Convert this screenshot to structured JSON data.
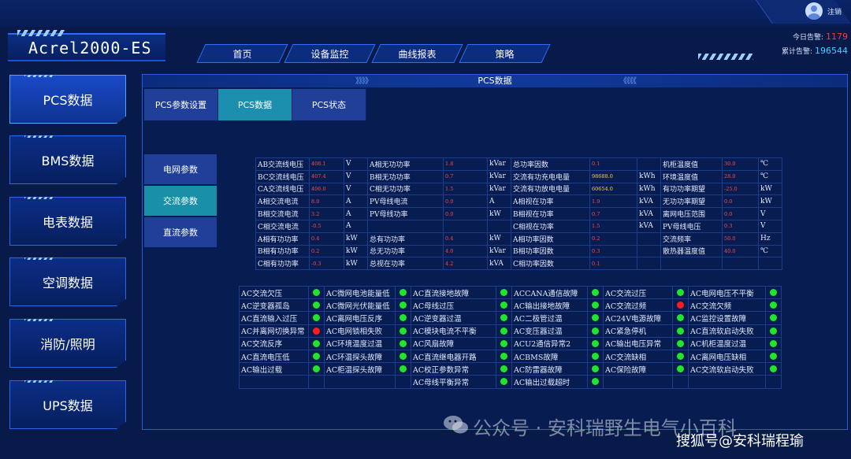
{
  "header": {
    "logout_label": "注销",
    "app_title": "Acrel2000-ES",
    "nav": [
      "首页",
      "设备监控",
      "曲线报表",
      "策略"
    ],
    "alarm": {
      "today_label": "今日告警:",
      "today_value": "1179",
      "total_label": "累计告警:",
      "total_value": "196544"
    }
  },
  "sidebar": {
    "items": [
      "PCS数据",
      "BMS数据",
      "电表数据",
      "空调数据",
      "消防/照明",
      "UPS数据"
    ],
    "active_index": 0
  },
  "panel": {
    "title": "PCS数据",
    "arrows_left": "》》》》",
    "arrows_right": "《《《《",
    "tabs": [
      "PCS参数设置",
      "PCS数据",
      "PCS状态"
    ],
    "active_tab": 1,
    "subtabs": [
      "电网参数",
      "交流参数",
      "直流参数"
    ],
    "active_subtab": 1
  },
  "data_rows": [
    [
      [
        "AB交流线电压",
        "408.1",
        "V"
      ],
      [
        "A相无功功率",
        "1.8",
        "kVar"
      ],
      [
        "总功率因数",
        "0.1",
        ""
      ],
      [
        "机柜温度值",
        "30.0",
        "℃"
      ]
    ],
    [
      [
        "BC交流线电压",
        "407.4",
        "V"
      ],
      [
        "B相无功功率",
        "0.7",
        "kVar"
      ],
      [
        "交流有功充电电量",
        "98688.0",
        "kWh"
      ],
      [
        "环境温度值",
        "28.0",
        "℃"
      ]
    ],
    [
      [
        "CA交流线电压",
        "406.0",
        "V"
      ],
      [
        "C相无功功率",
        "1.5",
        "kVar"
      ],
      [
        "交流有功放电电量",
        "60654.0",
        "kWh"
      ],
      [
        "有功功率期望",
        "-25.0",
        "kW"
      ]
    ],
    [
      [
        "A相交流电流",
        "8.0",
        "A"
      ],
      [
        "PV母线电流",
        "0.0",
        "A"
      ],
      [
        "A相视在功率",
        "1.9",
        "kVA"
      ],
      [
        "无功功率期望",
        "0.0",
        "kW"
      ]
    ],
    [
      [
        "B相交流电流",
        "3.2",
        "A"
      ],
      [
        "PV母线功率",
        "0.0",
        "kW"
      ],
      [
        "B相视在功率",
        "0.7",
        "kVA"
      ],
      [
        "离网电压范围",
        "0.0",
        "V"
      ]
    ],
    [
      [
        "C相交流电流",
        "-0.5",
        "A"
      ],
      [
        "",
        "",
        ""
      ],
      [
        "C相视在功率",
        "1.5",
        "kVA"
      ],
      [
        "PV母线电压",
        "0.3",
        "V"
      ]
    ],
    [
      [
        "A相有功功率",
        "0.4",
        "kW"
      ],
      [
        "总有功功率",
        "0.4",
        "kW"
      ],
      [
        "A相功率因数",
        "0.2",
        ""
      ],
      [
        "交流频率",
        "50.0",
        "Hz"
      ]
    ],
    [
      [
        "B相有功功率",
        "0.2",
        "kW"
      ],
      [
        "总无功功率",
        "4.0",
        "kVar"
      ],
      [
        "B相功率因数",
        "0.3",
        ""
      ],
      [
        "散热器温度值",
        "40.0",
        "℃"
      ]
    ],
    [
      [
        "C相有功功率",
        "-0.3",
        "kW"
      ],
      [
        "总视在功率",
        "4.2",
        "kVA"
      ],
      [
        "C相功率因数",
        "0.1",
        ""
      ],
      [
        "",
        "",
        ""
      ]
    ]
  ],
  "status_rows": [
    [
      [
        "AC交流欠压",
        "green"
      ],
      [
        "AC微网电池能量低",
        "green"
      ],
      [
        "AC直流接地故障",
        "green"
      ],
      [
        "ACCANA通信故障",
        "green"
      ],
      [
        "AC交流过压",
        "green"
      ],
      [
        "AC电网电压不平衡",
        "green"
      ]
    ],
    [
      [
        "AC逆变器孤岛",
        "green"
      ],
      [
        "AC微网光伏能量低",
        "green"
      ],
      [
        "AC母线过压",
        "green"
      ],
      [
        "AC输出接地故障",
        "green"
      ],
      [
        "AC交流过频",
        "red"
      ],
      [
        "AC交流欠频",
        "green"
      ]
    ],
    [
      [
        "AC直流输入过压",
        "green"
      ],
      [
        "AC离网电压反序",
        "green"
      ],
      [
        "AC逆变器过温",
        "green"
      ],
      [
        "AC二极管过温",
        "green"
      ],
      [
        "AC24V电源故障",
        "green"
      ],
      [
        "AC监控设置故障",
        "green"
      ]
    ],
    [
      [
        "AC并离网切换异常",
        "red"
      ],
      [
        "AC电网锁相失败",
        "green"
      ],
      [
        "AC模块电流不平衡",
        "green"
      ],
      [
        "AC变压器过温",
        "green"
      ],
      [
        "AC紧急停机",
        "green"
      ],
      [
        "AC直流软启动失败",
        "green"
      ]
    ],
    [
      [
        "AC交流反序",
        "green"
      ],
      [
        "AC环境温度过温",
        "green"
      ],
      [
        "AC风扇故障",
        "green"
      ],
      [
        "ACU2通信异常2",
        "green"
      ],
      [
        "AC输出电压异常",
        "green"
      ],
      [
        "AC机柜温度过温",
        "green"
      ]
    ],
    [
      [
        "AC直流电压低",
        "green"
      ],
      [
        "AC环温探头故障",
        "green"
      ],
      [
        "AC直流继电器开路",
        "green"
      ],
      [
        "ACBMS故障",
        "green"
      ],
      [
        "AC交流缺相",
        "green"
      ],
      [
        "AC离网电压缺相",
        "green"
      ]
    ],
    [
      [
        "AC输出过载",
        "green"
      ],
      [
        "AC柜温探头故障",
        "green"
      ],
      [
        "AC校正参数异常",
        "green"
      ],
      [
        "AC防雷器故障",
        "green"
      ],
      [
        "AC保险故障",
        "green"
      ],
      [
        "AC交流软启动失败",
        "green"
      ]
    ],
    [
      [
        "",
        ""
      ],
      [
        "",
        ""
      ],
      [
        "AC母线平衡异常",
        "green"
      ],
      [
        "AC输出过载超时",
        "green"
      ],
      [
        "",
        ""
      ],
      [
        "",
        ""
      ]
    ]
  ],
  "watermark": {
    "line1": "公众号 · 安科瑞野生电气小百科",
    "line2": "搜狐号@安科瑞程瑜"
  }
}
